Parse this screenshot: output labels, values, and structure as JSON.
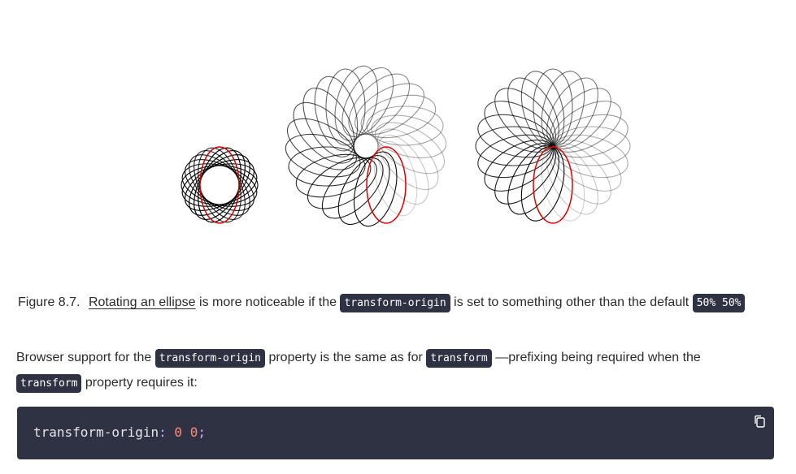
{
  "caption": {
    "figure_number": "Figure 8.7.",
    "link_text": "Rotating an ellipse",
    "text_before_code": "is more noticeable if the",
    "code1": "transform-origin",
    "text_after_code": "is set to something other than the default",
    "code2": "50% 50%"
  },
  "paragraph": {
    "part1": "Browser support for the",
    "code1": "transform-origin",
    "part2": "property is the same as for",
    "code2": "transform",
    "part3": "—prefixing being required when the",
    "code3": "transform",
    "part4": "property requires it:"
  },
  "code_block": {
    "property": "transform-origin",
    "colon": ":",
    "value1": "0",
    "value2": "0",
    "semicolon": ";",
    "copy_icon": "copy-icon"
  },
  "colors": {
    "ellipse_highlight": "#e00000",
    "ellipse_stroke": "#000000",
    "code_background": "#2f3243"
  }
}
